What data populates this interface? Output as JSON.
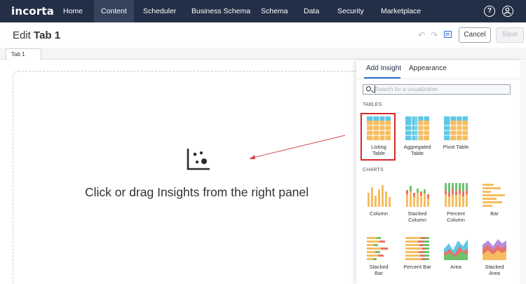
{
  "app": {
    "logo": "incorta"
  },
  "nav": {
    "items": [
      {
        "label": "Home",
        "active": false
      },
      {
        "label": "Content",
        "active": true
      },
      {
        "label": "Scheduler",
        "active": false
      },
      {
        "label": "Business Schema",
        "active": false
      },
      {
        "label": "Schema",
        "active": false
      },
      {
        "label": "Data",
        "active": false
      },
      {
        "label": "Security",
        "active": false
      },
      {
        "label": "Marketplace",
        "active": false
      }
    ],
    "help_icon": "help-circle-icon",
    "user_icon": "user-circle-icon"
  },
  "header": {
    "prefix": "Edit",
    "title": "Tab 1",
    "undo_icon": "undo-icon",
    "redo_icon": "redo-icon",
    "list_icon": "list-view-icon",
    "cancel_label": "Cancel",
    "save_label": "Save"
  },
  "tabs": [
    {
      "label": "Tab 1"
    }
  ],
  "canvas": {
    "message": "Click or drag Insights from the right panel",
    "icon": "scatter-chart-icon"
  },
  "panel": {
    "tabs": [
      {
        "label": "Add Insight",
        "active": true
      },
      {
        "label": "Appearance",
        "active": false
      }
    ],
    "search_placeholder": "Search for a visualization",
    "tables_heading": "TABLES",
    "charts_heading": "CHARTS",
    "tables": [
      {
        "label_l1": "Listing",
        "label_l2": "Table",
        "selected": true
      },
      {
        "label_l1": "Aggregated",
        "label_l2": "Table",
        "selected": false
      },
      {
        "label_l1": "Pivot Table",
        "label_l2": "",
        "selected": false
      }
    ],
    "charts": [
      {
        "label_l1": "Column",
        "label_l2": ""
      },
      {
        "label_l1": "Stacked",
        "label_l2": "Column"
      },
      {
        "label_l1": "Percent",
        "label_l2": "Column"
      },
      {
        "label_l1": "Bar",
        "label_l2": ""
      },
      {
        "label_l1": "Stacked",
        "label_l2": "Bar"
      },
      {
        "label_l1": "Percent Bar",
        "label_l2": ""
      },
      {
        "label_l1": "Area",
        "label_l2": ""
      },
      {
        "label_l1": "Stacked",
        "label_l2": "Area"
      }
    ]
  },
  "colors": {
    "nav_bg": "#232f47",
    "accent_blue": "#2e6fd1",
    "highlight_red": "#d42a2a",
    "table_orange": "#f6bd60",
    "table_cyan": "#5ec8e5",
    "chart_green": "#6cc36c",
    "chart_red": "#e8716b"
  }
}
